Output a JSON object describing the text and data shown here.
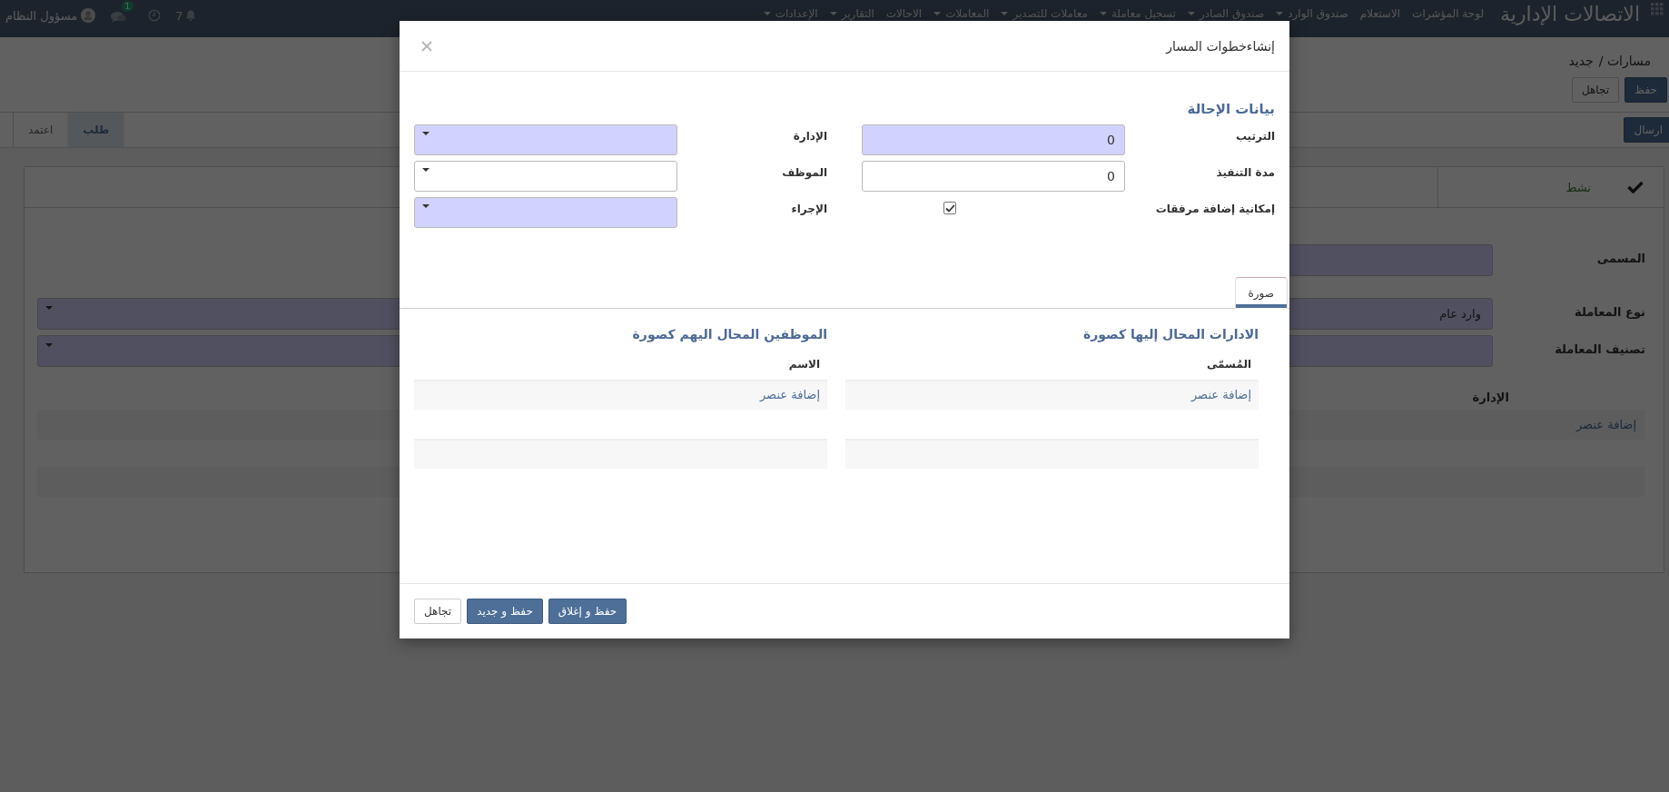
{
  "top_bar": {
    "brand": "الاتصالات الإدارية",
    "menu": [
      {
        "label": "لوحة المؤشرات",
        "dropdown": false
      },
      {
        "label": "الاستعلام",
        "dropdown": false
      },
      {
        "label": "صندوق الوارد",
        "dropdown": true
      },
      {
        "label": "صندوق الصادر",
        "dropdown": true
      },
      {
        "label": "تسجيل معاملة",
        "dropdown": true
      },
      {
        "label": "معاملات للتصدير",
        "dropdown": true
      },
      {
        "label": "المعاملات",
        "dropdown": true
      },
      {
        "label": "الاحالات",
        "dropdown": false
      },
      {
        "label": "التقارير",
        "dropdown": true
      },
      {
        "label": "الإعدادات",
        "dropdown": true
      }
    ],
    "notifications_count": "7",
    "chat_badge": "1",
    "user": "مسؤول النظام"
  },
  "breadcrumb": [
    "مسارات /",
    "جديد"
  ],
  "actions": [
    {
      "label": "حفظ",
      "kind": "primary"
    },
    {
      "label": "تجاهل",
      "kind": "default"
    }
  ],
  "workflow_button": "ارسال",
  "status_tabs": [
    {
      "label": "طلب",
      "selected": true
    },
    {
      "label": "اعتمد",
      "selected": false
    }
  ],
  "form": {
    "active_toggle": {
      "label": "نشط",
      "checked": true
    },
    "fields": [
      {
        "label": "المسمى",
        "kind": "text",
        "required": true
      },
      {
        "label": "نوع المعاملة",
        "kind": "select",
        "required": true,
        "value": "وارد عام"
      },
      {
        "label": "تصنيف المعاملة",
        "kind": "select",
        "required": true
      }
    ],
    "list": {
      "column": "الإدارة",
      "add_item": "إضافة عنصر"
    }
  },
  "dialog": {
    "title": "إنشاءخطوات المسار",
    "section_title": "بيانات الإحالة",
    "fields": [
      {
        "label": "الترتيب",
        "kind": "number",
        "required": true,
        "value": "0"
      },
      {
        "label": "الإدارة",
        "kind": "select",
        "required": true
      },
      {
        "label": "مدة التنفيذ",
        "kind": "number",
        "required": false,
        "value": "0"
      },
      {
        "label": "الموظف",
        "kind": "select",
        "required": false
      },
      {
        "label": "إمكانية إضافة مرفقات",
        "kind": "checkbox",
        "checked": true
      },
      {
        "label": "الإجراء",
        "kind": "select",
        "required": true
      }
    ],
    "tabs": [
      {
        "label": "صورة",
        "selected": true
      }
    ],
    "lists": [
      {
        "title": "الادارات المحال إليها كصورة",
        "column": "المُسمّى",
        "add_item": "إضافة عنصر"
      },
      {
        "title": "الموظفين المحال اليهم كصورة",
        "column": "الاسم",
        "add_item": "إضافة عنصر"
      }
    ],
    "buttons": [
      {
        "label": "حفظ و إغلاق",
        "kind": "primary"
      },
      {
        "label": "حفظ و جديد",
        "kind": "primary"
      },
      {
        "label": "تجاهل",
        "kind": "default"
      }
    ]
  }
}
